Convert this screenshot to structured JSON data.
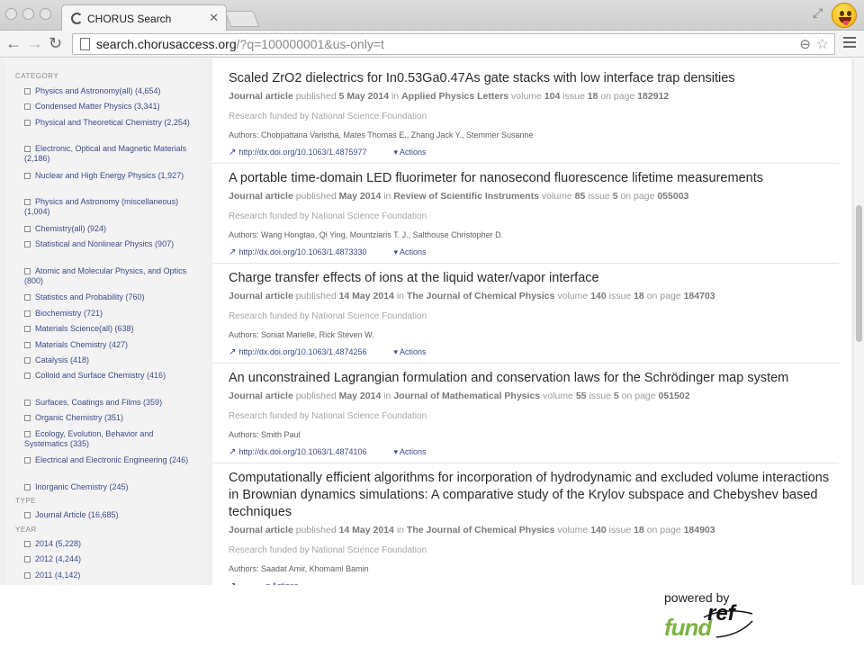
{
  "browser": {
    "tab_title": "CHORUS Search",
    "tab_close": "✕",
    "url_scheme": "",
    "url_host": "search.chorusaccess.org",
    "url_path": "/?q=100000001&us-only=t"
  },
  "sidebar": {
    "sections": [
      {
        "heading": "CATEGORY",
        "items": [
          "Physics and Astronomy(all) (4,654)",
          "Condensed Matter Physics (3,341)",
          "Physical and Theoretical Chemistry (2,254)",
          "Electronic, Optical and Magnetic Materials (2,186)",
          "Nuclear and High Energy Physics (1,927)",
          "Physics and Astronomy (miscellaneous) (1,004)",
          "Chemistry(all) (924)",
          "Statistical and Nonlinear Physics (907)",
          "Atomic and Molecular Physics, and Optics (800)",
          "Statistics and Probability (760)",
          "Biochemistry (721)",
          "Materials Science(all) (638)",
          "Materials Chemistry (427)",
          "Catalysis (418)",
          "Colloid and Surface Chemistry (416)",
          "Surfaces, Coatings and Films (359)",
          "Organic Chemistry (351)",
          "Ecology, Evolution, Behavior and Systematics (335)",
          "Electrical and Electronic Engineering (246)",
          "Inorganic Chemistry (245)"
        ]
      },
      {
        "heading": "TYPE",
        "items": [
          "Journal Article (16,685)"
        ]
      },
      {
        "heading": "YEAR",
        "items": [
          "2014 (5,228)",
          "2012 (4,244)",
          "2011 (4,142)"
        ]
      }
    ]
  },
  "labels": {
    "published": "published",
    "in": "in",
    "volume": "volume",
    "issue": "issue",
    "on_page": "on page",
    "authors_prefix": "Authors:",
    "actions": "Actions"
  },
  "results": [
    {
      "title": "Scaled ZrO2 dielectrics for In0.53Ga0.47As gate stacks with low interface trap densities",
      "type": "Journal article",
      "date": "5 May 2014",
      "journal": "Applied Physics Letters",
      "volume": "104",
      "issue": "18",
      "page": "182912",
      "funded": "Research funded by National Science Foundation",
      "authors": "Chobpattana Varistha, Mates Thomas E., Zhang Jack Y., Stemmer Susanne",
      "doi": "http://dx.doi.org/10.1063/1.4875977"
    },
    {
      "title": "A portable time-domain LED fluorimeter for nanosecond fluorescence lifetime measurements",
      "type": "Journal article",
      "date": "May 2014",
      "journal": "Review of Scientific Instruments",
      "volume": "85",
      "issue": "5",
      "page": "055003",
      "funded": "Research funded by National Science Foundation",
      "authors": "Wang Hongtao, Qi Ying, Mountziaris T. J., Salthouse Christopher D.",
      "doi": "http://dx.doi.org/10.1063/1.4873330"
    },
    {
      "title": "Charge transfer effects of ions at the liquid water/vapor interface",
      "type": "Journal article",
      "date": "14 May 2014",
      "journal": "The Journal of Chemical Physics",
      "volume": "140",
      "issue": "18",
      "page": "184703",
      "funded": "Research funded by National Science Foundation",
      "authors": "Soniat Marielle, Rick Steven W.",
      "doi": "http://dx.doi.org/10.1063/1.4874256"
    },
    {
      "title": "An unconstrained Lagrangian formulation and conservation laws for the Schrödinger map system",
      "type": "Journal article",
      "date": "May 2014",
      "journal": "Journal of Mathematical Physics",
      "volume": "55",
      "issue": "5",
      "page": "051502",
      "funded": "Research funded by National Science Foundation",
      "authors": "Smith Paul",
      "doi": "http://dx.doi.org/10.1063/1.4874106"
    },
    {
      "title": "Computationally efficient algorithms for incorporation of hydrodynamic and excluded volume interactions in Brownian dynamics simulations: A comparative study of the Krylov subspace and Chebyshev based techniques",
      "type": "Journal article",
      "date": "14 May 2014",
      "journal": "The Journal of Chemical Physics",
      "volume": "140",
      "issue": "18",
      "page": "184903",
      "funded": "Research funded by National Science Foundation",
      "authors": "Saadat Amir, Khomami Bamin",
      "doi": ""
    }
  ],
  "footer": {
    "powered_by": "powered by",
    "logo_fund": "fund",
    "logo_ref": "ref"
  }
}
